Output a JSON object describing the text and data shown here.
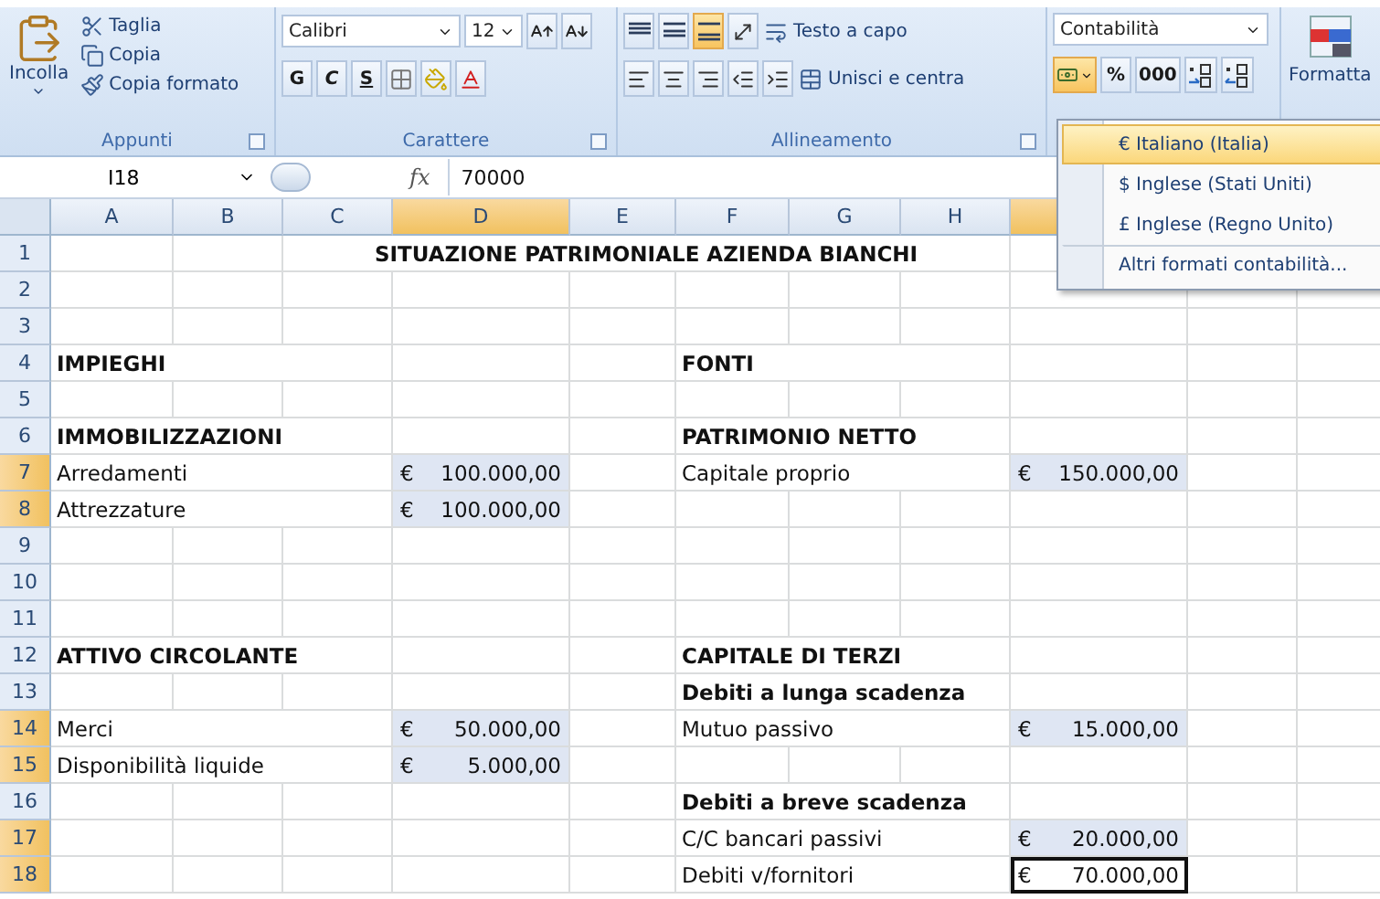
{
  "ribbon": {
    "groups": [
      {
        "kind": "clipboard",
        "label": "Appunti",
        "paste": "Incolla",
        "actions": [
          "Taglia",
          "Copia",
          "Copia formato"
        ]
      },
      {
        "kind": "font",
        "label": "Carattere",
        "font": "Calibri",
        "size": "12",
        "styles": [
          "G",
          "C",
          "S"
        ]
      },
      {
        "kind": "alignment",
        "label": "Allineamento",
        "wrap": "Testo a capo",
        "merge": "Unisci e centra",
        "vertical": [
          {
            "selected": false
          },
          {
            "selected": false
          },
          {
            "selected": true
          }
        ]
      },
      {
        "kind": "number",
        "format": "Contabilità",
        "percent": "%",
        "thousands": "000",
        "currency_open": true
      },
      {
        "kind": "styles",
        "label": "Formatta"
      }
    ]
  },
  "currency_menu": {
    "items": [
      {
        "text": "€ Italiano (Italia)",
        "selected": true
      },
      {
        "text": "$ Inglese (Stati Uniti)",
        "selected": false
      },
      {
        "text": "£ Inglese (Regno Unito)",
        "selected": false
      },
      {
        "text": "Altri formati contabilità...",
        "selected": false
      }
    ]
  },
  "formula_bar": {
    "cell": "I18",
    "function_label": "fx",
    "value": "70000"
  },
  "sheet": {
    "columns": [
      {
        "label": "A",
        "selected": false
      },
      {
        "label": "B",
        "selected": false
      },
      {
        "label": "C",
        "selected": false
      },
      {
        "label": "D",
        "selected": true
      },
      {
        "label": "E",
        "selected": false
      },
      {
        "label": "F",
        "selected": false
      },
      {
        "label": "G",
        "selected": false
      },
      {
        "label": "H",
        "selected": false
      },
      {
        "selected": true
      }
    ],
    "title": {
      "number": "1",
      "text": "SITUAZIONE PATRIMONIALE AZIENDA BIANCHI",
      "selected": false
    },
    "rows": [
      {
        "number": "2",
        "selected": false
      },
      {
        "number": "3",
        "selected": false
      },
      {
        "number": "4",
        "selected": false,
        "impieghi": {
          "text": "IMPIEGHI",
          "bold": true
        },
        "fonti": {
          "text": "FONTI",
          "bold": true
        }
      },
      {
        "number": "5",
        "selected": false
      },
      {
        "number": "6",
        "selected": false,
        "impieghi": {
          "text": "IMMOBILIZZAZIONI",
          "bold": true
        },
        "fonti": {
          "text": "PATRIMONIO NETTO",
          "bold": true
        }
      },
      {
        "number": "7",
        "selected": true,
        "impieghi": {
          "text": "Arredamenti",
          "currency": "€",
          "amount": "100.000,00",
          "selected": true
        },
        "fonti": {
          "text": "Capitale proprio",
          "currency": "€",
          "amount": "150.000,00",
          "selected": true
        }
      },
      {
        "number": "8",
        "selected": true,
        "impieghi": {
          "text": "Attrezzature",
          "currency": "€",
          "amount": "100.000,00",
          "selected": true
        }
      },
      {
        "number": "9",
        "selected": false
      },
      {
        "number": "10",
        "selected": false
      },
      {
        "number": "11",
        "selected": false
      },
      {
        "number": "12",
        "selected": false,
        "impieghi": {
          "text": "ATTIVO CIRCOLANTE",
          "bold": true
        },
        "fonti": {
          "text": "CAPITALE DI TERZI",
          "bold": true
        }
      },
      {
        "number": "13",
        "selected": false,
        "fonti": {
          "text": "Debiti a lunga scadenza",
          "bold": true
        }
      },
      {
        "number": "14",
        "selected": true,
        "impieghi": {
          "text": "Merci",
          "currency": "€",
          "amount": "50.000,00",
          "selected": true
        },
        "fonti": {
          "text": "Mutuo passivo",
          "currency": "€",
          "amount": "15.000,00",
          "selected": true
        }
      },
      {
        "number": "15",
        "selected": true,
        "impieghi": {
          "text": "Disponibilità liquide",
          "currency": "€",
          "amount": "5.000,00",
          "selected": true
        }
      },
      {
        "number": "16",
        "selected": false,
        "fonti": {
          "text": "Debiti a breve scadenza",
          "bold": true
        }
      },
      {
        "number": "17",
        "selected": true,
        "fonti": {
          "text": "C/C bancari passivi",
          "currency": "€",
          "amount": "20.000,00",
          "selected": true
        }
      },
      {
        "number": "18",
        "selected": true,
        "fonti": {
          "text": "Debiti v/fornitori",
          "currency": "€",
          "amount": "70.000,00",
          "selected": false,
          "active": true
        }
      }
    ]
  }
}
